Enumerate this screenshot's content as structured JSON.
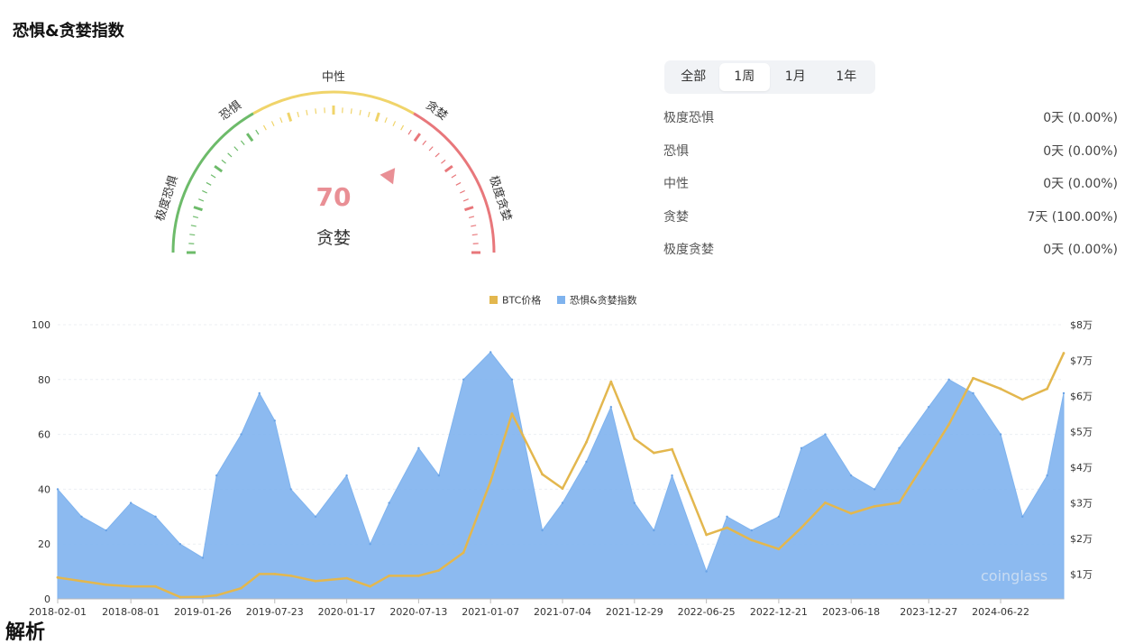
{
  "page_title": "恐惧&贪婪指数",
  "bottom_title": "解析",
  "gauge": {
    "value": "70",
    "value_num": 70,
    "label": "贪婪",
    "zones": [
      "极度恐惧",
      "恐惧",
      "中性",
      "贪婪",
      "极度贪婪"
    ],
    "colors": {
      "green": "#6dbb6a",
      "yellow": "#f0d46a",
      "red": "#e8777b",
      "value": "#e98f95",
      "pointer": "#e98f95"
    }
  },
  "tabs": [
    {
      "label": "全部",
      "active": false
    },
    {
      "label": "1周",
      "active": true
    },
    {
      "label": "1月",
      "active": false
    },
    {
      "label": "1年",
      "active": false
    }
  ],
  "stats": [
    {
      "label": "极度恐惧",
      "value": "0天 (0.00%)"
    },
    {
      "label": "恐惧",
      "value": "0天 (0.00%)"
    },
    {
      "label": "中性",
      "value": "0天 (0.00%)"
    },
    {
      "label": "贪婪",
      "value": "7天 (100.00%)"
    },
    {
      "label": "极度贪婪",
      "value": "0天 (0.00%)"
    }
  ],
  "chart_data": {
    "type": "area",
    "legend": [
      {
        "name": "BTC价格",
        "color": "#e3b74e"
      },
      {
        "name": "恐惧&贪婪指数",
        "color": "#7fb3ee"
      }
    ],
    "legend_position": "top-center",
    "x_ticks": [
      "2018-02-01",
      "2018-08-01",
      "2019-01-26",
      "2019-07-23",
      "2020-01-17",
      "2020-07-13",
      "2021-01-07",
      "2021-07-04",
      "2021-12-29",
      "2022-06-25",
      "2022-12-21",
      "2023-06-18",
      "2023-12-27",
      "2024-06-22"
    ],
    "y_left_ticks": [
      "0",
      "20",
      "40",
      "60",
      "80",
      "100"
    ],
    "y_left_range": [
      0,
      100
    ],
    "y_right_ticks": [
      "$1万",
      "$2万",
      "$3万",
      "$4万",
      "$5万",
      "$6万",
      "$7万",
      "$8万"
    ],
    "y_right_range": [
      3000,
      80000
    ],
    "watermark": "coinglass",
    "series": [
      {
        "name": "恐惧&贪婪指数",
        "x": [
          "2018-02-01",
          "2018-04-01",
          "2018-06-01",
          "2018-08-01",
          "2018-10-01",
          "2018-12-01",
          "2019-01-26",
          "2019-03-01",
          "2019-05-01",
          "2019-06-15",
          "2019-07-23",
          "2019-09-01",
          "2019-11-01",
          "2020-01-17",
          "2020-03-15",
          "2020-05-01",
          "2020-07-13",
          "2020-09-01",
          "2020-11-01",
          "2021-01-07",
          "2021-03-01",
          "2021-05-15",
          "2021-07-04",
          "2021-09-01",
          "2021-11-01",
          "2021-12-29",
          "2022-02-15",
          "2022-04-01",
          "2022-06-25",
          "2022-08-15",
          "2022-10-15",
          "2022-12-21",
          "2023-02-15",
          "2023-04-15",
          "2023-06-18",
          "2023-08-15",
          "2023-10-15",
          "2023-12-27",
          "2024-02-15",
          "2024-04-15",
          "2024-06-22",
          "2024-08-15",
          "2024-10-15",
          "2024-11-25"
        ],
        "values": [
          40,
          30,
          25,
          35,
          30,
          20,
          15,
          45,
          60,
          75,
          65,
          40,
          30,
          45,
          20,
          35,
          55,
          45,
          80,
          90,
          80,
          25,
          35,
          50,
          70,
          35,
          25,
          45,
          10,
          30,
          25,
          30,
          55,
          60,
          45,
          40,
          55,
          70,
          80,
          75,
          60,
          30,
          45,
          75
        ]
      },
      {
        "name": "BTC价格",
        "x": [
          "2018-02-01",
          "2018-04-01",
          "2018-06-01",
          "2018-08-01",
          "2018-10-01",
          "2018-12-01",
          "2019-01-26",
          "2019-03-01",
          "2019-05-01",
          "2019-06-15",
          "2019-07-23",
          "2019-09-01",
          "2019-11-01",
          "2020-01-17",
          "2020-03-15",
          "2020-05-01",
          "2020-07-13",
          "2020-09-01",
          "2020-11-01",
          "2021-01-07",
          "2021-03-01",
          "2021-05-15",
          "2021-07-04",
          "2021-09-01",
          "2021-11-01",
          "2021-12-29",
          "2022-02-15",
          "2022-04-01",
          "2022-06-25",
          "2022-08-15",
          "2022-10-15",
          "2022-12-21",
          "2023-02-15",
          "2023-04-15",
          "2023-06-18",
          "2023-08-15",
          "2023-10-15",
          "2023-12-27",
          "2024-02-15",
          "2024-04-15",
          "2024-06-22",
          "2024-08-15",
          "2024-10-15",
          "2024-11-25"
        ],
        "values": [
          9000,
          8000,
          7000,
          6500,
          6500,
          3500,
          3600,
          4000,
          6000,
          10000,
          10000,
          9500,
          8000,
          8800,
          6500,
          9500,
          9500,
          11000,
          16000,
          36000,
          55000,
          38000,
          34000,
          47000,
          64000,
          48000,
          44000,
          45000,
          21000,
          23000,
          19500,
          17000,
          23000,
          30000,
          27000,
          29000,
          30000,
          43000,
          52000,
          65000,
          62000,
          59000,
          62000,
          72000
        ]
      }
    ]
  }
}
